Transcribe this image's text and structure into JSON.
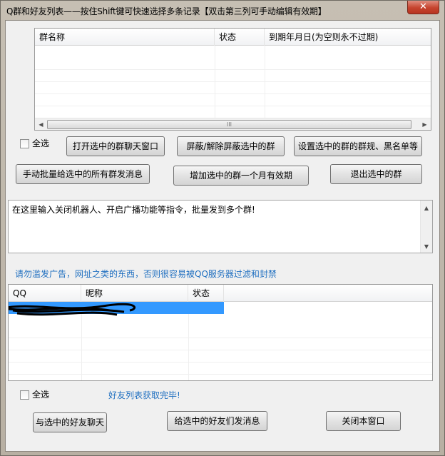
{
  "window": {
    "title": "Q群和好友列表——按住Shift键可快速选择多条记录【双击第三列可手动编辑有效期】",
    "close_glyph": "✕"
  },
  "group_list": {
    "columns": [
      "群名称",
      "状态",
      "到期年月日(为空则永不过期)"
    ],
    "rows": [],
    "scroll_left": "◀",
    "scroll_right": "▶",
    "scroll_grip": "III"
  },
  "group_actions": {
    "select_all": "全选",
    "open_chat": "打开选中的群聊天窗口",
    "toggle_block": "屏蔽/解除屏蔽选中的群",
    "set_rules": "设置选中的群的群规、黑名单等",
    "bulk_message": "手动批量给选中的所有群发消息",
    "extend_month": "增加选中的群一个月有效期",
    "quit_group": "退出选中的群"
  },
  "command_box": {
    "value": "在这里输入关闭机器人、开启广播功能等指令，批量发到多个群!",
    "up": "▲",
    "down": "▼"
  },
  "warning": "请勿滥发广告，网址之类的东西，否则很容易被QQ服务器过滤和封禁",
  "friend_list": {
    "columns": [
      "QQ",
      "昵称",
      "状态"
    ],
    "selected_row": {
      "qq": "",
      "nickname": "",
      "status": ""
    }
  },
  "friend_actions": {
    "select_all": "全选",
    "status": "好友列表获取完毕!",
    "chat": "与选中的好友聊天",
    "send_message": "给选中的好友们发消息",
    "close": "关闭本窗口"
  }
}
